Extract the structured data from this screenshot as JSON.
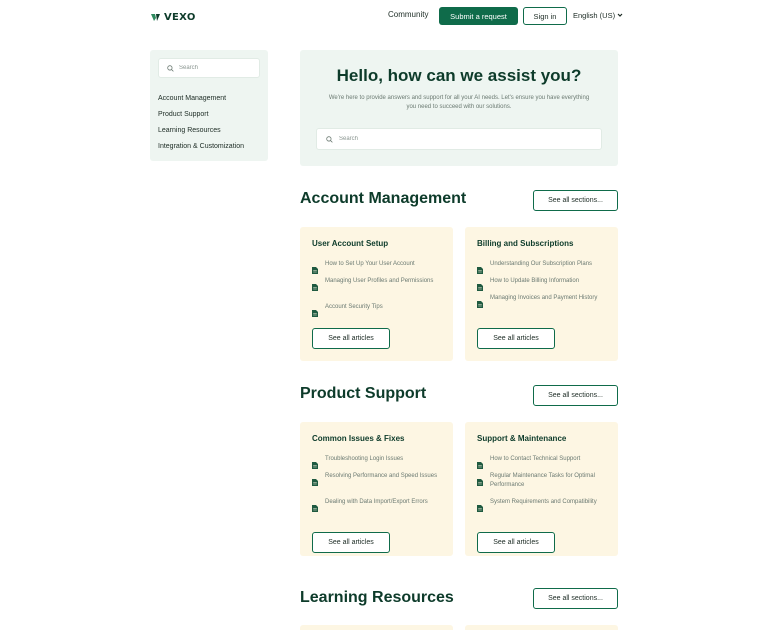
{
  "brand": {
    "name": "VEXO",
    "accent": "#0f6b4a",
    "dark": "#0d3b2a",
    "card_bg": "#fdf6e3",
    "panel_bg": "#eef5f1"
  },
  "header": {
    "community": "Community",
    "submit": "Submit a request",
    "signin": "Sign in",
    "language": "English (US)"
  },
  "sidebar": {
    "search_placeholder": "Search",
    "items": [
      {
        "label": "Account Management"
      },
      {
        "label": "Product Support"
      },
      {
        "label": "Learning Resources"
      },
      {
        "label": "Integration & Customization"
      }
    ]
  },
  "hero": {
    "title": "Hello, how can we assist you?",
    "subtitle": "We're here to provide answers and support for all your AI needs. Let's ensure you have everything you need to succeed with our solutions.",
    "search_placeholder": "Search"
  },
  "sections": [
    {
      "title": "Account Management",
      "see_all_sections": "See all sections...",
      "cards": [
        {
          "title": "User Account Setup",
          "articles": [
            "How to Set Up Your User Account",
            "Managing User Profiles and Permissions",
            "Account Security Tips"
          ],
          "see_all": "See all articles"
        },
        {
          "title": "Billing and Subscriptions",
          "articles": [
            "Understanding Our Subscription Plans",
            "How to Update Billing Information",
            "Managing Invoices and Payment History"
          ],
          "see_all": "See all articles"
        }
      ]
    },
    {
      "title": "Product Support",
      "see_all_sections": "See all sections...",
      "cards": [
        {
          "title": "Common Issues & Fixes",
          "articles": [
            "Troubleshooting Login Issues",
            "Resolving Performance and Speed Issues",
            "Dealing with Data Import/Export Errors"
          ],
          "see_all": "See all articles"
        },
        {
          "title": "Support & Maintenance",
          "articles": [
            "How to Contact Technical Support",
            "Regular Maintenance Tasks for Optimal Performance",
            "System Requirements and Compatibility"
          ],
          "see_all": "See all articles"
        }
      ]
    },
    {
      "title": "Learning Resources",
      "see_all_sections": "See all sections..."
    }
  ]
}
